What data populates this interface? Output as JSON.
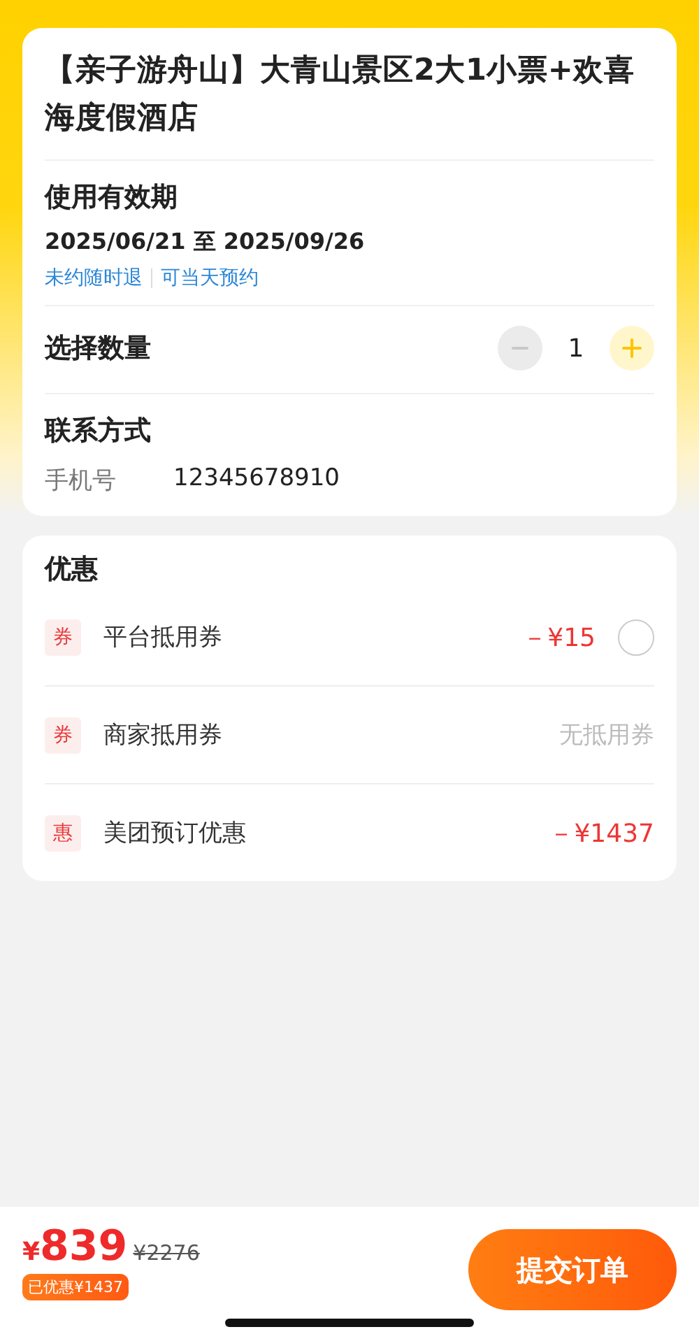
{
  "product": {
    "title": "【亲子游舟山】大青山景区2大1小票+欢喜海度假酒店"
  },
  "validity": {
    "heading": "使用有效期",
    "dates": "2025/06/21 至 2025/09/26",
    "tags": [
      "未约随时退",
      "可当天预约"
    ]
  },
  "quantity": {
    "label": "选择数量",
    "value": "1",
    "minus_disabled": true,
    "plus_disabled": false
  },
  "contact": {
    "heading": "联系方式",
    "label": "手机号",
    "value": "12345678910"
  },
  "discounts": {
    "heading": "优惠",
    "items": [
      {
        "tag": "券",
        "name": "平台抵用券",
        "kind": "radio",
        "value": "－¥15",
        "selected": false
      },
      {
        "tag": "券",
        "name": "商家抵用券",
        "kind": "note",
        "value": "无抵用券"
      },
      {
        "tag": "惠",
        "name": "美团预订优惠",
        "kind": "amount",
        "value": "－¥1437"
      }
    ]
  },
  "footer": {
    "currency": "¥",
    "price": "839",
    "original_price": "¥2276",
    "saved": "已优惠¥1437",
    "submit": "提交订单"
  }
}
